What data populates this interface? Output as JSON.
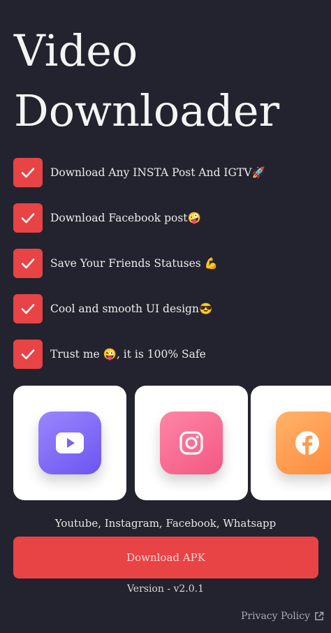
{
  "header": {
    "title_line1": "Video",
    "title_line2": "Downloader"
  },
  "features": [
    {
      "text": "Download Any INSTA Post And IGTV🚀"
    },
    {
      "text": "Download Facebook post🤪"
    },
    {
      "text": "Save Your Friends Statuses 💪"
    },
    {
      "text": " Cool and smooth UI design😎"
    },
    {
      "text": "Trust me 😜, it is 100% Safe"
    }
  ],
  "apps": [
    {
      "icon": "youtube-icon",
      "color": "#7a63f6"
    },
    {
      "icon": "instagram-icon",
      "color": "#f65f89"
    },
    {
      "icon": "facebook-icon",
      "color": "#ff9a4d"
    }
  ],
  "platforms_text": "Youtube, Instagram, Facebook, Whatsapp",
  "download_button": {
    "label": "Download APK",
    "color": "#e84345"
  },
  "version_text": "Version - v2.0.1",
  "privacy": {
    "label": "Privacy Policy",
    "icon": "external-link-icon"
  },
  "colors": {
    "background": "#23232f",
    "accent": "#e84345"
  }
}
